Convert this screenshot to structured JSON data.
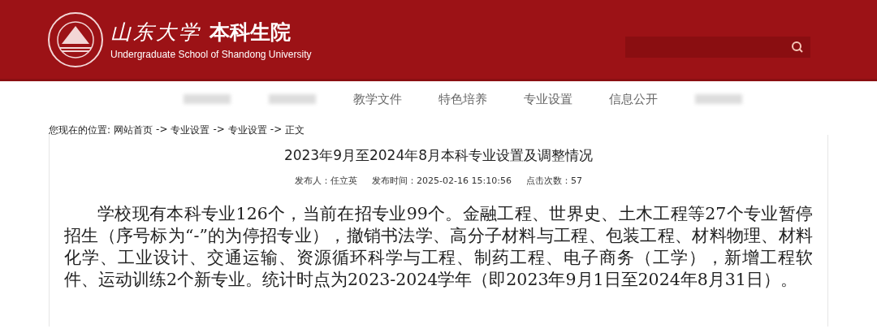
{
  "header": {
    "logo_text": "山东大学",
    "title": "本科生院",
    "subtitle": "Undergraduate School of Shandong University"
  },
  "nav": [
    {
      "kind": "blurred"
    },
    {
      "kind": "blurred"
    },
    {
      "kind": "text",
      "label": "教学文件"
    },
    {
      "kind": "text",
      "label": "特色培养"
    },
    {
      "kind": "text",
      "label": "专业设置"
    },
    {
      "kind": "text",
      "label": "信息公开"
    },
    {
      "kind": "blurred"
    }
  ],
  "breadcrumb": {
    "prefix": "您现在的位置:",
    "items": [
      "网站首页",
      "专业设置",
      "专业设置",
      "正文"
    ],
    "separator": "->"
  },
  "article": {
    "title": "2023年9月至2024年8月本科专业设置及调整情况",
    "meta": [
      "发布人：任立英",
      "发布时间：2025-02-16 15:10:56",
      "点击次数：57"
    ],
    "paragraphs": [
      "学校现有本科专业126个，当前在招专业99个。金融工程、世界史、土木工程等27个专业暂停招生（序号标为“-”的为停招专业），撤销书法学、高分子材料与工程、包装工程、材料物理、材料化学、工业设计、交通运输、资源循环科学与工程、制药工程、电子商务（工学），新增工程软件、运动训练2个新专业。统计时点为2023-2024学年（即2023年9月1日至2024年8月31日）。"
    ]
  }
}
